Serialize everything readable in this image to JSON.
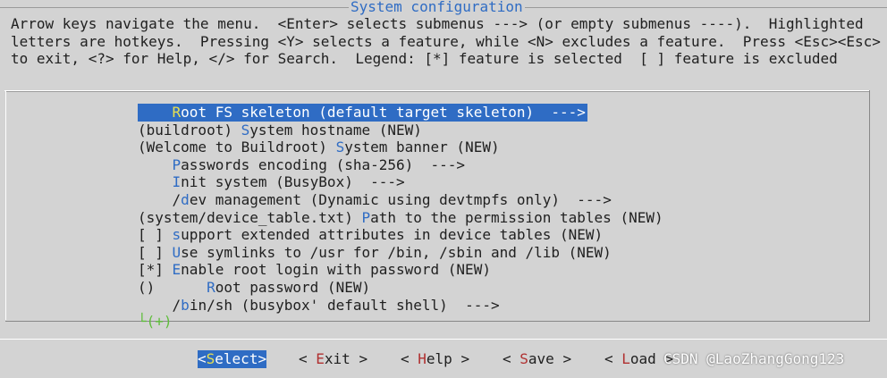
{
  "window": {
    "title": "System configuration"
  },
  "help_lines": [
    "Arrow keys navigate the menu.  <Enter> selects submenus ---> (or empty submenus ----).  Highlighted",
    "letters are hotkeys.  Pressing <Y> selects a feature, while <N> excludes a feature.  Press <Esc><Esc>",
    "to exit, <?> for Help, </> for Search.  Legend: [*] feature is selected  [ ] feature is excluded"
  ],
  "menu": [
    {
      "prefix": "    ",
      "hot": "R",
      "rest": "oot FS skeleton (default target skeleton)  --->",
      "selected": true
    },
    {
      "prefix": "(buildroot) ",
      "hot": "S",
      "rest": "ystem hostname (NEW)",
      "selected": false
    },
    {
      "prefix": "(Welcome to Buildroot) ",
      "hot": "S",
      "rest": "ystem banner (NEW)",
      "selected": false
    },
    {
      "prefix": "    ",
      "hot": "P",
      "rest": "asswords encoding (sha-256)  --->",
      "selected": false
    },
    {
      "prefix": "    ",
      "hot": "I",
      "rest": "nit system (BusyBox)  --->",
      "selected": false
    },
    {
      "prefix": "    /",
      "hot": "d",
      "rest": "ev management (Dynamic using devtmpfs only)  --->",
      "selected": false
    },
    {
      "prefix": "(system/device_table.txt) ",
      "hot": "P",
      "rest": "ath to the permission tables (NEW)",
      "selected": false
    },
    {
      "prefix": "[ ] ",
      "hot": "s",
      "rest": "upport extended attributes in device tables (NEW)",
      "selected": false
    },
    {
      "prefix": "[ ] ",
      "hot": "U",
      "rest": "se symlinks to /usr for /bin, /sbin and /lib (NEW)",
      "selected": false
    },
    {
      "prefix": "[*] ",
      "hot": "E",
      "rest": "nable root login with password (NEW)",
      "selected": false
    },
    {
      "prefix": "()      ",
      "hot": "R",
      "rest": "oot password (NEW)",
      "selected": false
    },
    {
      "prefix": "    /",
      "hot": "b",
      "rest": "in/sh (busybox' default shell)  --->",
      "selected": false
    }
  ],
  "more_indicator": "└(+)",
  "buttons": [
    {
      "pre": "<",
      "hot": "S",
      "post": "elect>",
      "selected": true
    },
    {
      "pre": "< ",
      "hot": "E",
      "post": "xit >",
      "selected": false
    },
    {
      "pre": "< ",
      "hot": "H",
      "post": "elp >",
      "selected": false
    },
    {
      "pre": "< ",
      "hot": "S",
      "post": "ave >",
      "selected": false
    },
    {
      "pre": "< ",
      "hot": "L",
      "post": "oad >",
      "selected": false
    }
  ],
  "watermark": "CSDN @LaoZhangGong123"
}
